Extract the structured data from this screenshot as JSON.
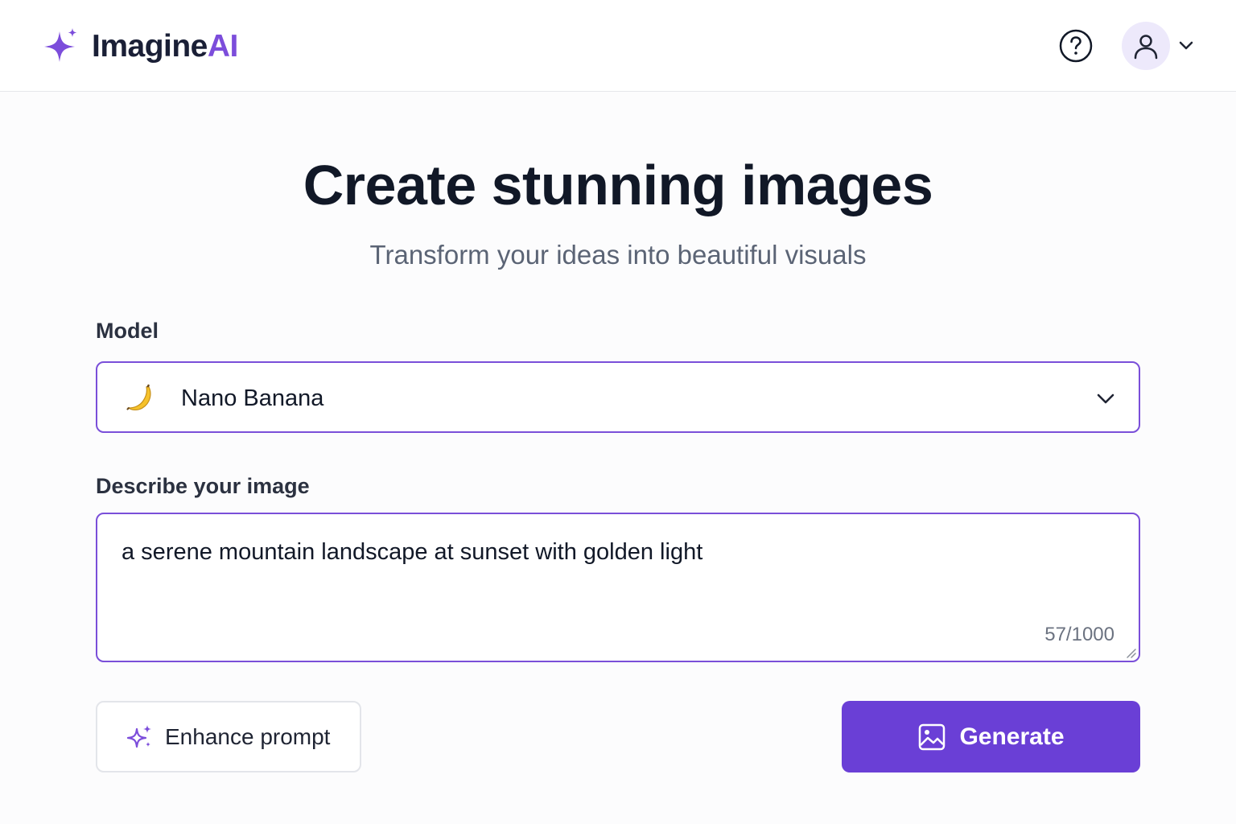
{
  "app": {
    "brand_name": "Imagine",
    "brand_accent": "AI",
    "accent_color": "#7c4ddb"
  },
  "header": {
    "help_icon": "help-circle-icon",
    "avatar_icon": "user-icon",
    "menu_icon": "chevron-down-icon"
  },
  "hero": {
    "title": "Create stunning images",
    "subtitle": "Transform your ideas into beautiful visuals"
  },
  "form": {
    "model_label": "Model",
    "model_value": "Nano Banana",
    "model_icon": "banana-icon",
    "description_label": "Describe your image",
    "description_value": "a serene mountain landscape at sunset with golden light",
    "char_count": "57/1000"
  },
  "actions": {
    "enhance_label": "Enhance prompt",
    "enhance_icon": "sparkles-icon",
    "generate_label": "Generate",
    "generate_icon": "image-icon",
    "generate_color": "#6a3fd6"
  }
}
